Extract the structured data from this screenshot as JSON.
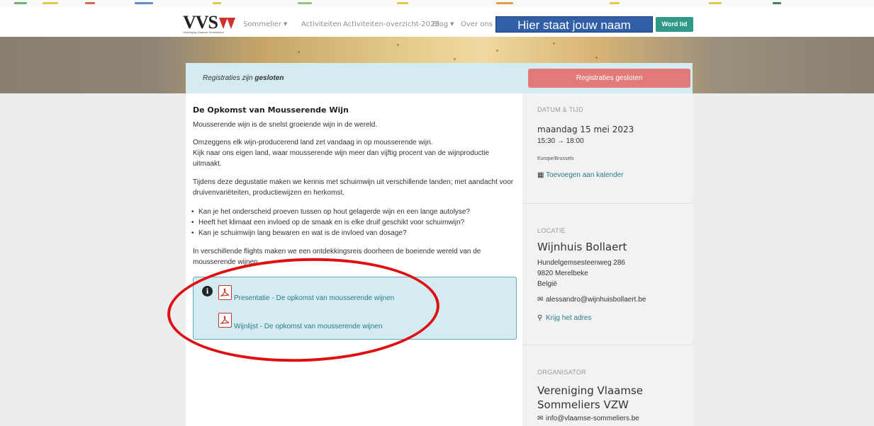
{
  "header": {
    "logo_text": "VVS",
    "logo_subtitle": "Vereniging Vlaamse Sommeliers",
    "nav": [
      {
        "label": "Sommelier",
        "dropdown": true
      },
      {
        "label": "Activiteiten",
        "dropdown": false
      },
      {
        "label": "Activiteiten-overzicht-2023",
        "dropdown": false
      },
      {
        "label": "Blog",
        "dropdown": true
      },
      {
        "label": "Over ons",
        "dropdown": false
      }
    ],
    "name_placeholder": "Hier staat jouw naam",
    "join_button": "Word lid"
  },
  "registration": {
    "status_prefix": "Registraties zijn",
    "status_bold": "gesloten",
    "button_label": "Registraties gesloten"
  },
  "event": {
    "title": "De Opkomst van Mousserende Wijn",
    "paragraphs": [
      "Mousserende wijn is de snelst groeiende wijn in de wereld.",
      "Omzeggens elk wijn-producerend land zet vandaag in op mousserende wijn.",
      "Kijk naar ons eigen land, waar mousserende wijn meer dan vijftig procent van de wijnproductie uitmaakt.",
      "Tijdens deze degustatie maken we kennis met schuimwijn uit verschillende landen; met aandacht voor druivenvariëteiten, productiewijzen en herkomst.",
      "In verschillende flights maken we een ontdekkingsreis doorheen de boeiende wereld van de mousserende wijnen."
    ],
    "bullets": [
      "Kan je het onderscheid proeven tussen op hout gelagerde wijn en een lange autolyse?",
      "Heeft het klimaat een invloed op de smaak en is elke druif geschikt voor schuimwijn?",
      "Kan je schuimwijn lang bewaren en wat is de invloed van dosage?"
    ],
    "attachments": [
      {
        "label": "Presentatie - De opkomst van mousserende wijnen",
        "icon": "pdf-icon"
      },
      {
        "label": "Wijnlijst - De opkomst van mousserende wijnen",
        "icon": "pdf-icon"
      }
    ]
  },
  "sidebar": {
    "datetime_label": "DATUM & TIJD",
    "date": "maandag 15 mei 2023",
    "time": "15:30 → 18:00",
    "timezone": "Europe/Brussels",
    "calendar_link": "Toevoegen aan kalender",
    "location_label": "LOCATIE",
    "location_name": "Wijnhuis Bollaert",
    "address_lines": [
      "Hundelgemsesteenweg 286",
      "9820 Merelbeke",
      "België"
    ],
    "location_email": "alessandro@wijnhuisbollaert.be",
    "directions_link": "Krijg het adres",
    "organizer_label": "ORGANISATOR",
    "organizer_name": "Vereniging Vlaamse Sommeliers VZW",
    "organizer_email": "info@vlaamse-sommeliers.be"
  },
  "colors": {
    "accent_teal": "#2f9a8a",
    "closed_red": "#e27a7a",
    "info_bg": "#d4ecf1",
    "name_box": "#2f5fa6",
    "annotation_red": "#e01010"
  }
}
